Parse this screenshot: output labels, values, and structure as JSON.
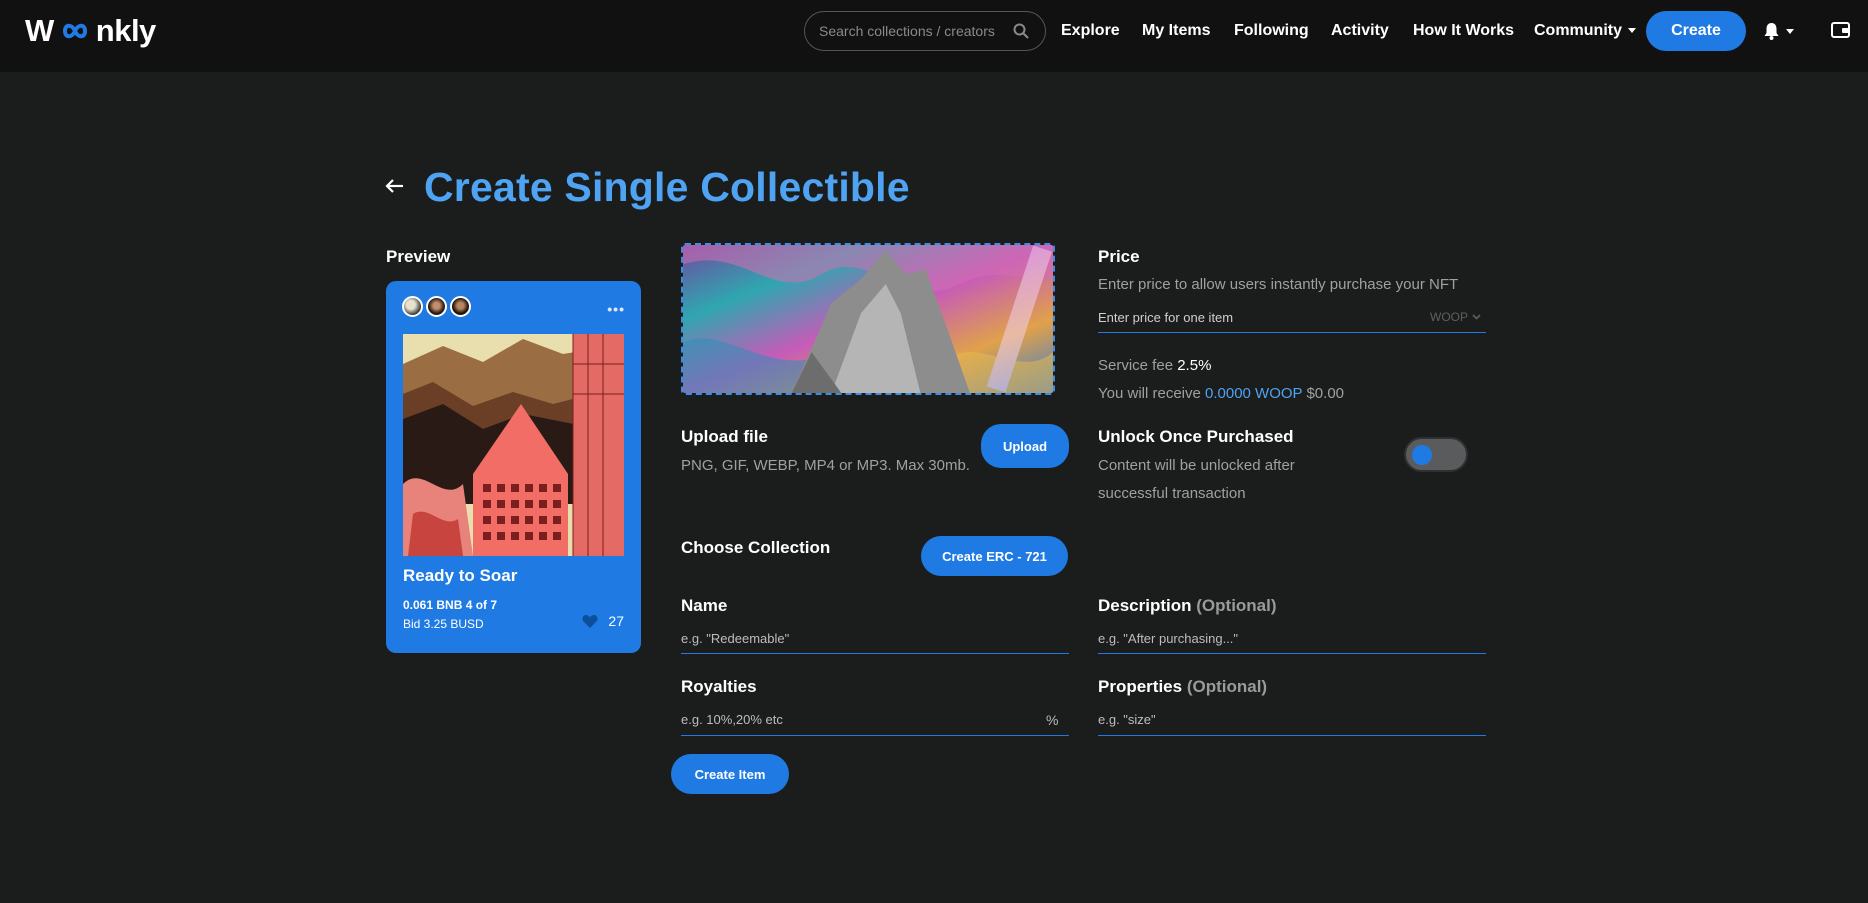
{
  "header": {
    "logo": "Woonkly",
    "search_placeholder": "Search collections / creators",
    "nav": [
      "Explore",
      "My Items",
      "Following",
      "Activity",
      "How It Works",
      "Community"
    ],
    "create_label": "Create"
  },
  "page": {
    "title": "Create Single Collectible"
  },
  "preview": {
    "heading": "Preview",
    "card": {
      "title": "Ready to Soar",
      "price": "0.061 BNB 4 of 7",
      "bid": "Bid 3.25 BUSD",
      "likes": "27",
      "more": "•••"
    }
  },
  "upload": {
    "title": "Upload file",
    "hint": "PNG, GIF, WEBP, MP4 or MP3. Max 30mb.",
    "button": "Upload"
  },
  "collection": {
    "title": "Choose Collection",
    "button": "Create ERC - 721"
  },
  "price": {
    "title": "Price",
    "hint": "Enter price to allow users instantly purchase your NFT",
    "placeholder": "Enter price for one item",
    "currency": "WOOP",
    "service_fee_label": "Service fee",
    "service_fee_value": "2.5%",
    "receive_label": "You will receive",
    "receive_value": "0.0000 WOOP",
    "receive_usd": "$0.00"
  },
  "unlock": {
    "title": "Unlock Once Purchased",
    "hint_line1": "Content will be unlocked after",
    "hint_line2": "successful transaction",
    "enabled": false
  },
  "form": {
    "name_label": "Name",
    "name_placeholder": "e.g. \"Redeemable\"",
    "description_label": "Description",
    "description_optional": "(Optional)",
    "description_placeholder": "e.g. \"After purchasing...\"",
    "royalties_label": "Royalties",
    "royalties_placeholder": "e.g. 10%,20% etc",
    "royalties_unit": "%",
    "properties_label": "Properties",
    "properties_optional": "(Optional)",
    "properties_placeholder": "e.g. \"size\"",
    "submit_label": "Create Item"
  },
  "colors": {
    "accent": "#1f7be3",
    "title": "#4ea3f2",
    "background": "#1b1c1c",
    "header": "#111111"
  }
}
